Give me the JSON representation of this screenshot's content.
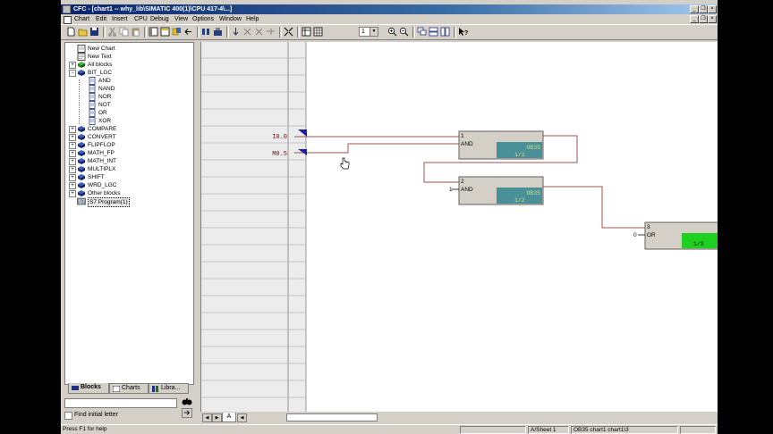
{
  "window": {
    "title": "CFC - [chart1 -- why_lib\\SIMATIC 400(1)\\CPU 417-4\\...]",
    "min_glyph": "_",
    "restore_glyph": "❐",
    "close_glyph": "×"
  },
  "menu": [
    "Chart",
    "Edit",
    "Insert",
    "CPU",
    "Debug",
    "View",
    "Options",
    "Window",
    "Help"
  ],
  "toolbar": {
    "zoom_value": "1",
    "buttons": [
      "new-icon",
      "open-icon",
      "save-icon",
      "print-icon",
      "cut-icon",
      "copy-icon",
      "paste-icon",
      "catalog-icon",
      "block-icon",
      "program-icon",
      "sheet-left-icon",
      "sheet-right-icon",
      "compile-icon",
      "download-icon",
      "test-mode-icon",
      "watch-icon",
      "monitor-icon",
      "interconnect-icon",
      "sheet-view-icon",
      "overview-icon",
      "zoom-in-icon",
      "zoom-out-icon",
      "window-cascade-icon",
      "window-tile-h-icon",
      "window-tile-v-icon",
      "help-context-icon"
    ]
  },
  "tree": {
    "items": [
      {
        "label": "New Chart",
        "exp": "",
        "icon": "chart",
        "indent": 0
      },
      {
        "label": "New Text",
        "exp": "",
        "icon": "text",
        "indent": 0
      },
      {
        "label": "All blocks",
        "exp": "+",
        "icon": "books-green",
        "indent": 0
      },
      {
        "label": "BIT_LGC",
        "exp": "−",
        "icon": "books",
        "indent": 0
      },
      {
        "label": "AND",
        "exp": "",
        "icon": "block",
        "indent": 1
      },
      {
        "label": "NAND",
        "exp": "",
        "icon": "block",
        "indent": 1
      },
      {
        "label": "NOR",
        "exp": "",
        "icon": "block",
        "indent": 1
      },
      {
        "label": "NOT",
        "exp": "",
        "icon": "block",
        "indent": 1
      },
      {
        "label": "OR",
        "exp": "",
        "icon": "block",
        "indent": 1
      },
      {
        "label": "XOR",
        "exp": "",
        "icon": "block",
        "indent": 1
      },
      {
        "label": "COMPARE",
        "exp": "+",
        "icon": "books",
        "indent": 0
      },
      {
        "label": "CONVERT",
        "exp": "+",
        "icon": "books",
        "indent": 0
      },
      {
        "label": "FLIPFLOP",
        "exp": "+",
        "icon": "books",
        "indent": 0
      },
      {
        "label": "MATH_FP",
        "exp": "+",
        "icon": "books",
        "indent": 0
      },
      {
        "label": "MATH_INT",
        "exp": "+",
        "icon": "books",
        "indent": 0
      },
      {
        "label": "MULTIPLX",
        "exp": "+",
        "icon": "books",
        "indent": 0
      },
      {
        "label": "SHIFT",
        "exp": "+",
        "icon": "books",
        "indent": 0
      },
      {
        "label": "WRD_LGC",
        "exp": "+",
        "icon": "books",
        "indent": 0
      },
      {
        "label": "Other blocks",
        "exp": "+",
        "icon": "books",
        "indent": 0
      },
      {
        "label": "S7 Program(1)",
        "exp": "",
        "icon": "program",
        "indent": 0,
        "selected": true
      }
    ]
  },
  "tabs": {
    "blocks": "Blocks",
    "charts": "Charts",
    "libraries": "Libra..."
  },
  "search": {
    "value": "",
    "find_label": "Find initial letter"
  },
  "chart": {
    "margin_inputs": [
      {
        "address": "I0.0"
      },
      {
        "address": "M0.5"
      }
    ],
    "blocks": [
      {
        "id": "blk1",
        "number": "1",
        "type": "AND",
        "task": "OB35",
        "seq": "1/1"
      },
      {
        "id": "blk2",
        "number": "2",
        "type": "AND",
        "task": "OB35",
        "seq": "1/2",
        "pin_in": "1"
      },
      {
        "id": "blk3",
        "number": "3",
        "type": "OR",
        "task": "OB35",
        "seq": "1/3",
        "pin_in": "0"
      }
    ]
  },
  "sheetbar": {
    "tab": "A"
  },
  "status": {
    "help": "Press F1 for help",
    "sheet": "A/Sheet 1",
    "location": "OB35 chart1 chart1\\3"
  },
  "colors": {
    "wire": "#a05050",
    "block_body": "#d4d0c8",
    "task_field": "#4a9098",
    "task_field_active": "#20d020",
    "marker": "#1e1ea0"
  }
}
